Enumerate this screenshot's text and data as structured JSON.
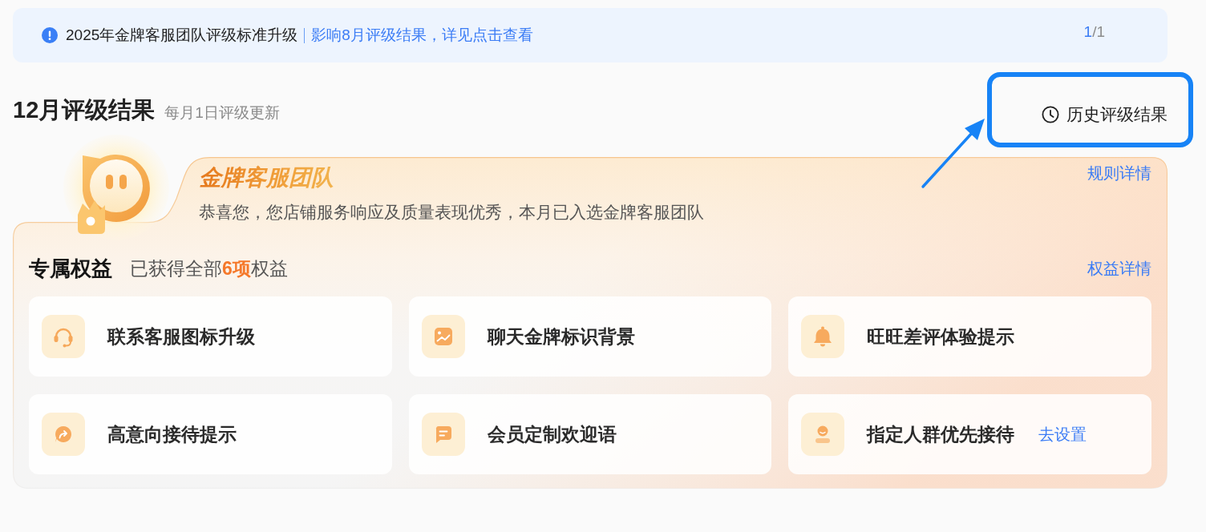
{
  "notice": {
    "title": "2025年金牌客服团队评级标准升级",
    "link": "影响8月评级结果，详见点击查看",
    "pager": {
      "current": "1",
      "of_total": "/1"
    }
  },
  "heading": {
    "title": "12月评级结果",
    "subtitle": "每月1日评级更新"
  },
  "history": {
    "label": "历史评级结果",
    "highlighted": true
  },
  "team_card": {
    "title": "金牌客服团队",
    "description": "恭喜您，您店铺服务响应及质量表现优秀，本月已入选金牌客服团队",
    "rules_link": "规则详情"
  },
  "benefits": {
    "title": "专属权益",
    "summary": "已获得全部**6项**权益",
    "details_link": "权益详情",
    "items": [
      {
        "label": "联系客服图标升级"
      },
      {
        "label": "聊天金牌标识背景"
      },
      {
        "label": "旺旺差评体验提示"
      },
      {
        "label": "高意向接待提示"
      },
      {
        "label": "会员定制欢迎语"
      },
      {
        "label": "指定人群优先接待",
        "action": "去设置"
      }
    ]
  }
}
